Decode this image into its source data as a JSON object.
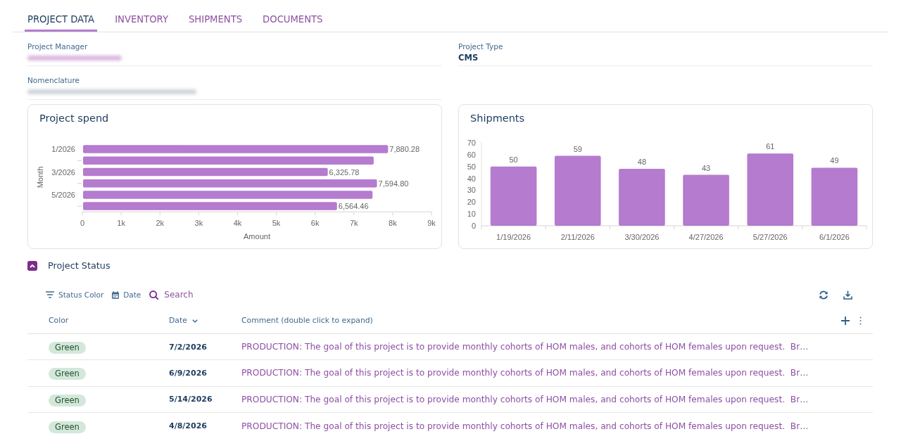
{
  "tabs": [
    {
      "label": "PROJECT DATA",
      "selected": true
    },
    {
      "label": "INVENTORY",
      "selected": false
    },
    {
      "label": "SHIPMENTS",
      "selected": false
    },
    {
      "label": "DOCUMENTS",
      "selected": false
    }
  ],
  "fields": [
    {
      "label": "Project Manager",
      "kind": "link",
      "value_redacted": true
    },
    {
      "label": "Project Type",
      "kind": "text",
      "value": "CMS"
    },
    {
      "label": "Nomenclature",
      "kind": "text",
      "value_redacted": true
    }
  ],
  "charts": [
    {
      "chart_data": {
        "type": "bar",
        "orientation": "horizontal",
        "title": "Project spend",
        "xlabel": "Amount",
        "ylabel": "Month",
        "categories": [
          "1/2026",
          null,
          "3/2026",
          null,
          "5/2026",
          null
        ],
        "values": [
          7880.28,
          7510,
          6325.78,
          7594.8,
          7480,
          6564.46
        ],
        "xlim": [
          0,
          9000
        ],
        "xticks": [
          0,
          {
            "value": 1000,
            "label": "1k"
          },
          {
            "value": 2000,
            "label": "2k"
          },
          {
            "value": 3000,
            "label": "3k"
          },
          {
            "value": 4000,
            "label": "4k"
          },
          {
            "value": 5000,
            "label": "5k"
          },
          {
            "value": 6000,
            "label": "6k"
          },
          {
            "value": 7000,
            "label": "7k"
          },
          {
            "value": 8000,
            "label": "8k"
          },
          {
            "value": 9000,
            "label": "9k"
          }
        ],
        "value_labels": [
          "7,880.28",
          null,
          "6,325.78",
          "7,594.80",
          null,
          "6,564.46"
        ]
      }
    },
    {
      "chart_data": {
        "type": "bar",
        "orientation": "vertical",
        "title": "Shipments",
        "categories": [
          "1/19/2026",
          "2/11/2026",
          "3/30/2026",
          "4/27/2026",
          "5/27/2026",
          "6/1/2026"
        ],
        "values": [
          50,
          59,
          48,
          43,
          61,
          49
        ],
        "ylim": [
          0,
          70
        ],
        "yticks": [
          0,
          10,
          20,
          30,
          40,
          50,
          60,
          70
        ],
        "data_labels": true
      }
    }
  ],
  "project_status": {
    "title": "Project Status",
    "expanded": true,
    "filters": [
      {
        "kind": "filter",
        "label": "Status Color"
      },
      {
        "kind": "calendar",
        "label": "Date"
      }
    ],
    "search": {
      "placeholder": "Search"
    },
    "table": {
      "columns": [
        {
          "label": "Color",
          "sorted": false
        },
        {
          "label": "Date",
          "sorted": true
        },
        {
          "label": "Comment (double click to expand)",
          "sorted": false
        }
      ],
      "rows": [
        {
          "status": "Green",
          "color": "#d3e8da",
          "date": "7/2/2026",
          "comment": "PRODUCTION: The goal of this project is to provide monthly cohorts of HOM males, and cohorts of HOM females upon request.  Br…"
        },
        {
          "status": "Green",
          "color": "#d3e8da",
          "date": "6/9/2026",
          "comment": "PRODUCTION: The goal of this project is to provide monthly cohorts of HOM males, and cohorts of HOM females upon request.  Br…"
        },
        {
          "status": "Green",
          "color": "#d3e8da",
          "date": "5/14/2026",
          "comment": "PRODUCTION: The goal of this project is to provide monthly cohorts of HOM males, and cohorts of HOM females upon request.  Br…"
        },
        {
          "status": "Green",
          "color": "#d3e8da",
          "date": "4/8/2026",
          "comment": "PRODUCTION: The goal of this project is to provide monthly cohorts of HOM males, and cohorts of HOM females upon request.  Br…"
        }
      ]
    }
  }
}
